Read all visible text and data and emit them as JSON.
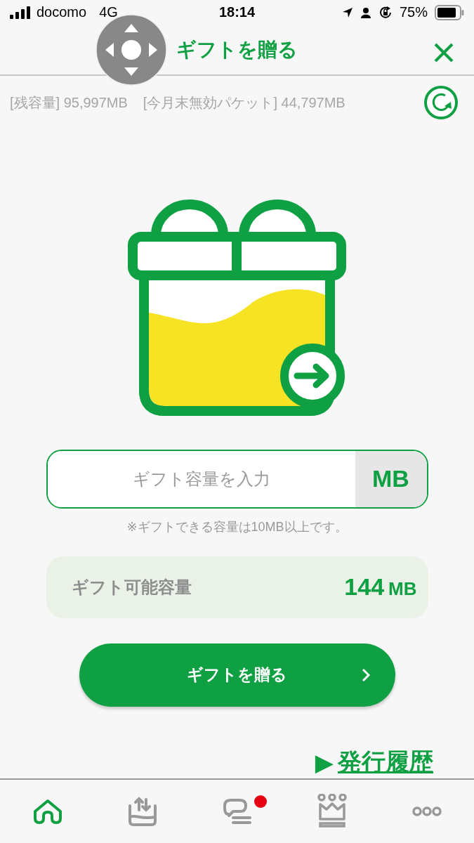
{
  "status_bar": {
    "carrier": "docomo",
    "network": "4G",
    "time": "18:14",
    "battery": "75%"
  },
  "header": {
    "title": "ギフトを贈る"
  },
  "balance": {
    "remaining": "[残容量] 95,997MB",
    "expiring": "[今月末無効パケット] 44,797MB"
  },
  "gift_input": {
    "placeholder": "ギフト容量を入力",
    "unit": "MB",
    "note": "※ギフトできる容量は10MB以上です。"
  },
  "available": {
    "label": "ギフト可能容量",
    "value": "144",
    "unit": "MB"
  },
  "submit_button": {
    "label": "ギフトを贈る"
  },
  "history_link": {
    "arrow": "▶",
    "label": "発行履歴"
  },
  "tab_bar": {
    "items": [
      {
        "kind": "home",
        "selected": true,
        "badge": false
      },
      {
        "kind": "transfer",
        "selected": false,
        "badge": false
      },
      {
        "kind": "chat",
        "selected": false,
        "badge": true
      },
      {
        "kind": "crown",
        "selected": false,
        "badge": false
      },
      {
        "kind": "more",
        "selected": false,
        "badge": false
      }
    ]
  }
}
